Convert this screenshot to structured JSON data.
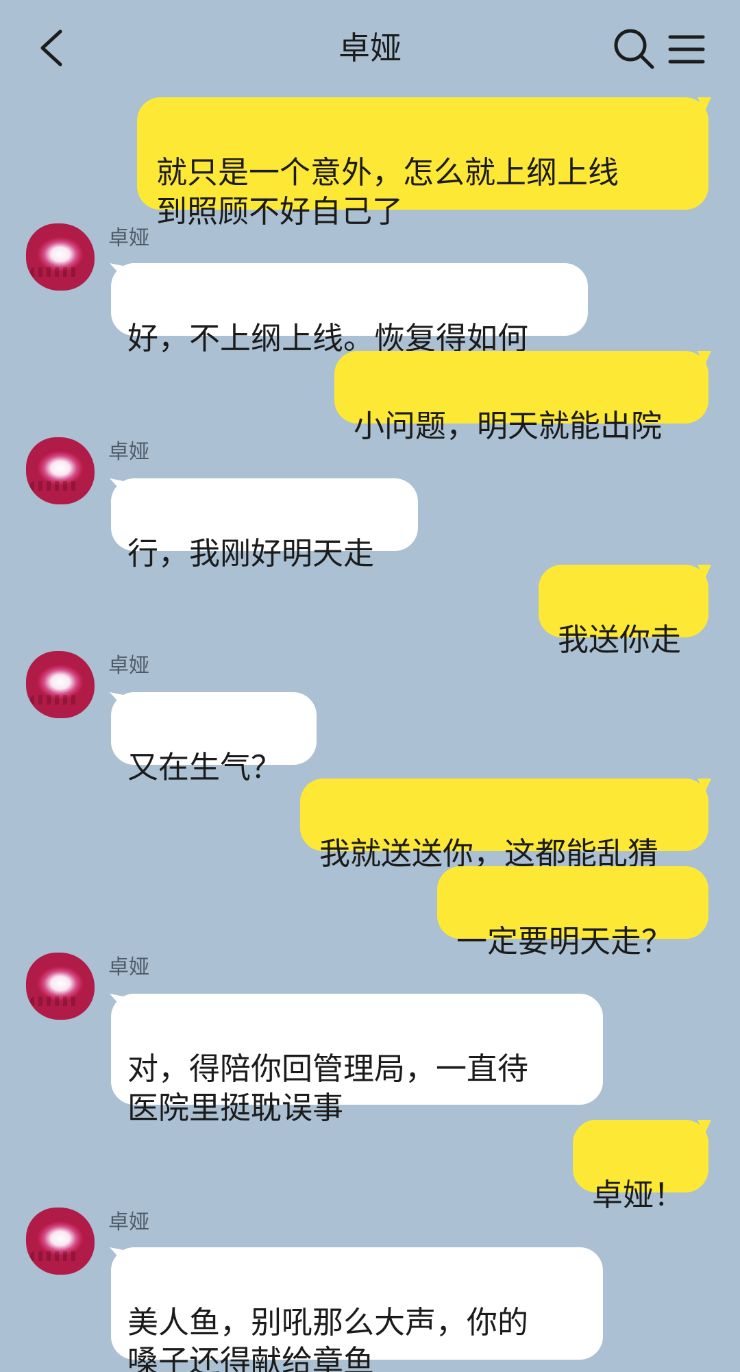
{
  "header": {
    "title": "卓娅"
  },
  "messages": [
    {
      "side": "me",
      "text": "就只是一个意外，怎么就上纲上线\n到照顾不好自己了"
    },
    {
      "side": "them",
      "sender": "卓娅",
      "text": "好，不上纲上线。恢复得如何"
    },
    {
      "side": "me",
      "text": "小问题，明天就能出院"
    },
    {
      "side": "them",
      "sender": "卓娅",
      "text": "行，我刚好明天走"
    },
    {
      "side": "me",
      "text": "我送你走"
    },
    {
      "side": "them",
      "sender": "卓娅",
      "text": "又在生气？"
    },
    {
      "side": "me",
      "text": "我就送送你，这都能乱猜"
    },
    {
      "side": "me",
      "text": "一定要明天走？"
    },
    {
      "side": "them",
      "sender": "卓娅",
      "text": "对，得陪你回管理局，一直待\n医院里挺耽误事"
    },
    {
      "side": "me",
      "text": "卓娅！"
    },
    {
      "side": "them",
      "sender": "卓娅",
      "text": "美人鱼，别吼那么大声，你的\n嗓子还得献给章鱼"
    }
  ],
  "colors": {
    "background": "#abc0d2",
    "my_bubble": "#fde935",
    "their_bubble": "#ffffff"
  },
  "icons": [
    "back-arrow-icon",
    "search-icon",
    "menu-icon"
  ]
}
